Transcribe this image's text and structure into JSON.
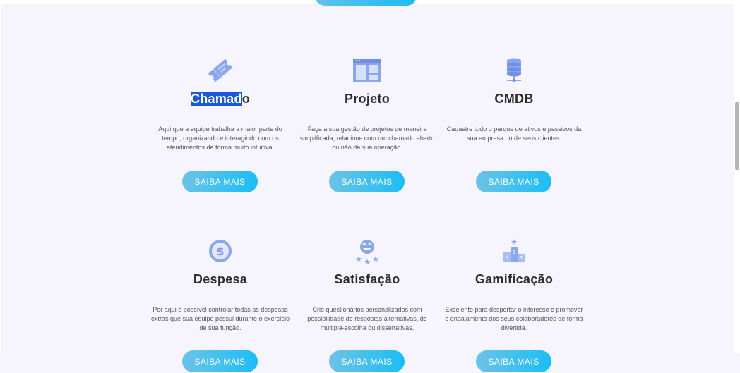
{
  "cards": [
    {
      "title_selected": "Chamad",
      "title_rest": "o",
      "title": "Chamado",
      "desc": "Aqui que a equipe trabalha a maior parte do tempo, organizando e interagindo com os atendimentos de forma muito intuitiva.",
      "button": "SAIBA MAIS",
      "icon": "ticket-icon"
    },
    {
      "title": "Projeto",
      "desc": "Faça a sua gestão de projetos de maneira simplificada, relacione com um chamado aberto ou não da sua operação.",
      "button": "SAIBA MAIS",
      "icon": "kanban-board-icon"
    },
    {
      "title": "CMDB",
      "desc": "Cadastre todo o parque de ativos e passivos da sua empresa ou de seus clientes.",
      "button": "SAIBA MAIS",
      "icon": "database-server-icon"
    },
    {
      "title": "Despesa",
      "desc": "Por aqui é possível controlar todas as despesas extras que sua equipe possui durante o exercício de sua função.",
      "button": "SAIBA MAIS",
      "icon": "dollar-coin-icon"
    },
    {
      "title": "Satisfação",
      "desc": "Crie questionários personalizados com possibilidade de respostas alternativas, de múltipla-escolha ou dissertativas.",
      "button": "SAIBA MAIS",
      "icon": "smiley-stars-icon"
    },
    {
      "title": "Gamificação",
      "desc": "Excelente para despertar o interesse e promover o engajamento dos seus colaboradores de forma divertida.",
      "button": "SAIBA MAIS",
      "icon": "podium-icon"
    }
  ],
  "colors": {
    "accent_start": "#6cc3e6",
    "accent_end": "#1bbdf6",
    "selection": "#1a57d9",
    "icon": "#7f9bea"
  }
}
